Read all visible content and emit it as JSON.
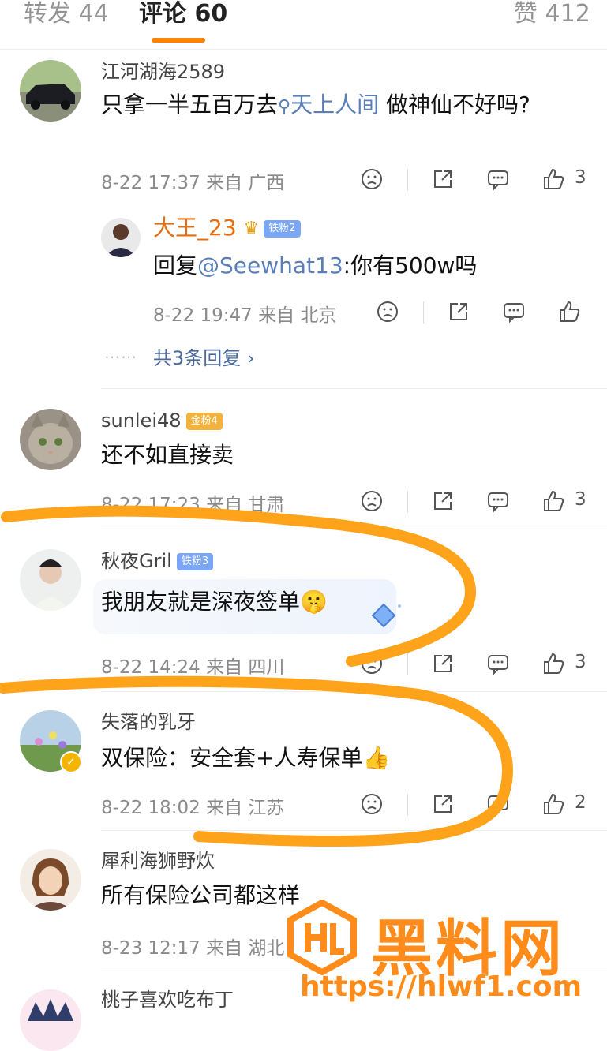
{
  "tabs": {
    "forward": "转发 44",
    "comments": "评论 60",
    "likes": "赞 412"
  },
  "comments": [
    {
      "user": "江河湖海2589",
      "text_before": "只拿一半五百万去",
      "search_link": "天上人间",
      "text_after": " 做神仙不好吗?",
      "meta": "8-22 17:37 来自 广西",
      "like_count": "3"
    },
    {
      "user": "大王_23",
      "badge": "铁粉2",
      "reply_prefix": "回复",
      "mention": "@Seewhat13",
      "reply_text": ":你有500w吗",
      "meta": "8-22 19:47 来自 北京",
      "like_count": "",
      "more_replies": "共3条回复"
    },
    {
      "user": "sunlei48",
      "badge": "金粉4",
      "text": "还不如直接卖",
      "meta": "8-22 17:23 来自 甘肃",
      "like_count": "3"
    },
    {
      "user": "秋夜Gril",
      "badge": "铁粉3",
      "text": "我朋友就是深夜签单🤫",
      "meta": "8-22 14:24 来自 四川",
      "like_count": "3"
    },
    {
      "user": "失落的乳牙",
      "text": "双保险：安全套+人寿保单👍",
      "meta": "8-22 18:02 来自 江苏",
      "like_count": "2"
    },
    {
      "user": "犀利海狮野炊",
      "text": "所有保险公司都这样",
      "meta": "8-23 12:17 来自 湖北"
    },
    {
      "user": "桃子喜欢吃布丁"
    }
  ],
  "watermark": {
    "title": "黑料网",
    "url": "https://hlwf1.com"
  },
  "colors": {
    "accent": "#ff8200",
    "link": "#5a7fb8",
    "annotation": "#ffa31a"
  }
}
